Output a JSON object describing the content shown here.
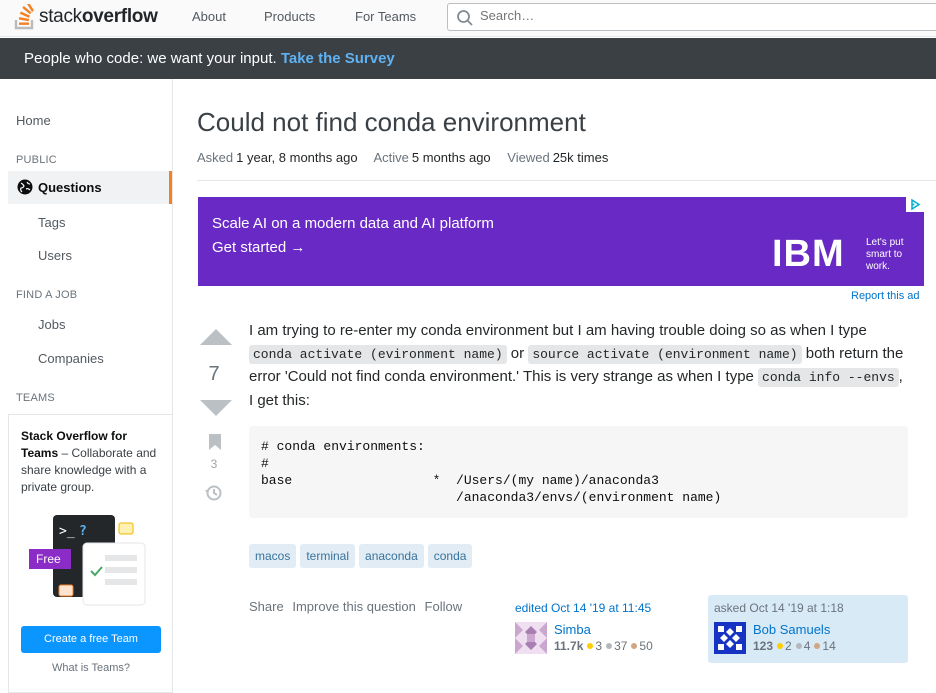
{
  "topbar": {
    "logo_light": "stack",
    "logo_bold": "overflow",
    "nav": [
      "About",
      "Products",
      "For Teams"
    ],
    "search_placeholder": "Search…"
  },
  "banner": {
    "text": "People who code: we want your input.",
    "link": "Take the Survey"
  },
  "sidebar": {
    "home": "Home",
    "public_heading": "PUBLIC",
    "active_item": "Questions",
    "public_items": [
      "Tags",
      "Users"
    ],
    "job_heading": "FIND A JOB",
    "job_items": [
      "Jobs",
      "Companies"
    ],
    "teams_heading": "TEAMS",
    "teams_title_bold": "Stack Overflow for Teams",
    "teams_title_rest": " – Collaborate and share knowledge with a private group.",
    "teams_free_label": "Free",
    "teams_button": "Create a free Team",
    "teams_what": "What is Teams?"
  },
  "question": {
    "title": "Could not find conda environment",
    "meta": {
      "asked_label": "Asked",
      "asked_value": "1 year, 8 months ago",
      "active_label": "Active",
      "active_value": "5 months ago",
      "viewed_label": "Viewed",
      "viewed_value": "25k times"
    },
    "votes": "7",
    "bookmarks": "3",
    "body": {
      "p1": "I am trying to re-enter my conda environment but I am having trouble doing so as when I type ",
      "code1": "conda activate (evironment name)",
      "p2": " or ",
      "code2": "source activate (environment name)",
      "p3": " both return the error 'Could not find conda environment.' This is very strange as when I type ",
      "code3": "conda info --envs",
      "p4": ", I get this:"
    },
    "code_block": "# conda environments:\n#\nbase                  *  /Users/(my name)/anaconda3\n                         /anaconda3/envs/(environment name)",
    "tags": [
      "macos",
      "terminal",
      "anaconda",
      "conda"
    ],
    "actions": [
      "Share",
      "Improve this question",
      "Follow"
    ]
  },
  "ad": {
    "line1": "Scale AI on a modern data and AI platform",
    "line2": "Get started →",
    "brand": "IBM",
    "tagline": "Let's put smart to work.",
    "report": "Report this ad"
  },
  "editor": {
    "time": "edited Oct 14 '19 at 11:45",
    "name": "Simba",
    "rep": "11.7k",
    "gold": "3",
    "silver": "37",
    "bronze": "50"
  },
  "owner": {
    "time": "asked Oct 14 '19 at 1:18",
    "name": "Bob Samuels",
    "rep": "123",
    "gold": "2",
    "silver": "4",
    "bronze": "14"
  },
  "colors": {
    "accent": "#f48024",
    "link": "#0074cc",
    "ad_bg": "#6929c4",
    "banner_bg": "#3b4045",
    "gold": "#ffcc01",
    "silver": "#b4b8bc",
    "bronze": "#d1a684"
  }
}
